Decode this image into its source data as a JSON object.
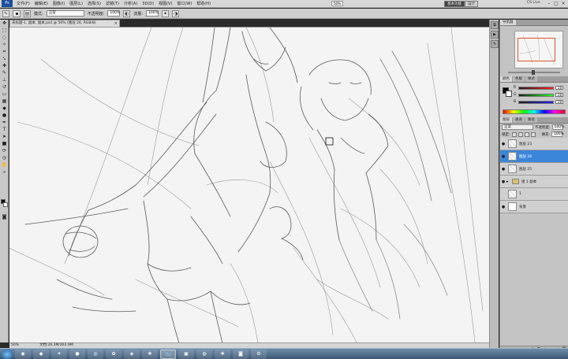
{
  "menubar": {
    "app_mark": "Ps",
    "items": [
      "文件(F)",
      "编辑(E)",
      "图像(I)",
      "图层(L)",
      "选择(S)",
      "滤镜(T)",
      "分析(A)",
      "3D(D)",
      "视图(V)",
      "窗口(W)",
      "帮助(H)"
    ],
    "zoom": "50%",
    "workspace_basic": "基本功能",
    "workspace_design": "设计",
    "cs_live": "CS Live"
  },
  "options": {
    "mode_label": "模式:",
    "mode_value": "正常",
    "opacity_label": "不透明度:",
    "opacity_value": "100%",
    "flow_label": "流量:",
    "flow_value": "100%"
  },
  "document": {
    "tab_title": "未标题-1, 副本, 副本.psd @ 50% (图层 26, RGB/8)",
    "status_zoom": "50%",
    "status_doc": "文档:26.3M/261.9M"
  },
  "navigator": {
    "tabs": [
      "导航器"
    ]
  },
  "color": {
    "tabs": [
      "颜色",
      "色板",
      "样式"
    ],
    "channels": [
      {
        "label": "R",
        "value": "28"
      },
      {
        "label": "G",
        "value": "28"
      },
      {
        "label": "B",
        "value": "28"
      }
    ]
  },
  "layers": {
    "tabs": [
      "图层",
      "通道",
      "路径"
    ],
    "blend_mode": "正常",
    "opacity_label": "不透明度:",
    "opacity_value": "100%",
    "lock_label": "锁定:",
    "fill_label": "填充:",
    "fill_value": "100%",
    "items": [
      {
        "name": "图层 23",
        "selected": false,
        "type": "layer"
      },
      {
        "name": "图层 26",
        "selected": true,
        "type": "layer"
      },
      {
        "name": "图层 25",
        "selected": false,
        "type": "layer"
      },
      {
        "name": "组 1 副本",
        "selected": false,
        "type": "group"
      },
      {
        "name": "1",
        "selected": false,
        "type": "layer"
      },
      {
        "name": "背景",
        "selected": false,
        "type": "background"
      }
    ]
  },
  "taskbar": {
    "ps_label": "Ps"
  },
  "icons": {
    "tools": [
      "move-icon",
      "marquee-icon",
      "lasso-icon",
      "quick-select-icon",
      "crop-icon",
      "eyedropper-icon",
      "healing-icon",
      "brush-icon",
      "clone-stamp-icon",
      "history-brush-icon",
      "eraser-icon",
      "gradient-icon",
      "blur-icon",
      "dodge-icon",
      "pen-icon",
      "type-icon",
      "path-select-icon",
      "shape-icon",
      "3d-rotate-icon",
      "3d-camera-icon",
      "hand-icon",
      "zoom-icon"
    ]
  }
}
